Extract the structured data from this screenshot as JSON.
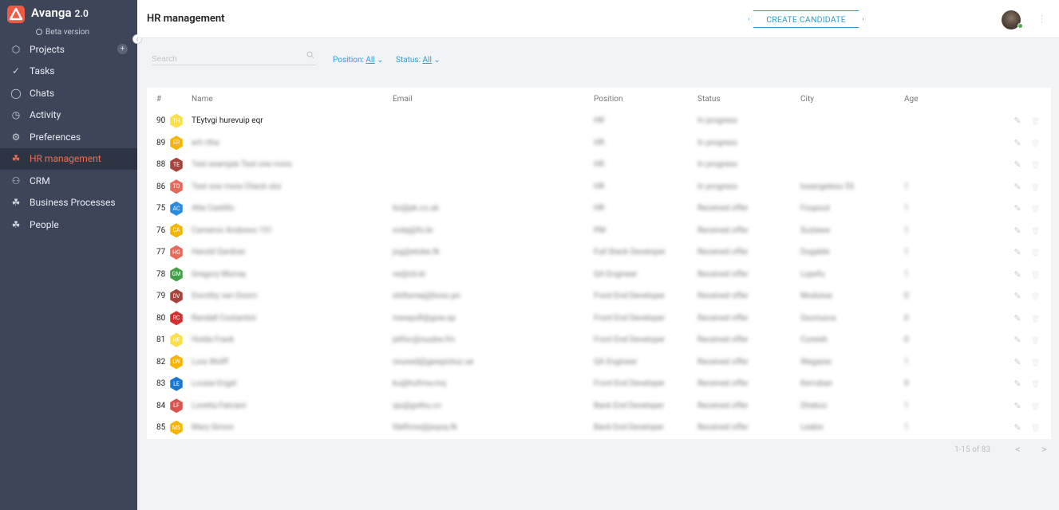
{
  "app": {
    "name": "Avanga",
    "version": "2.0",
    "subtitle": "Beta version"
  },
  "sidebar": {
    "items": [
      {
        "label": "Projects",
        "icon": "cube-icon"
      },
      {
        "label": "Tasks",
        "icon": "check-circle-icon"
      },
      {
        "label": "Chats",
        "icon": "chat-bubble-icon"
      },
      {
        "label": "Activity",
        "icon": "stopwatch-icon"
      },
      {
        "label": "Preferences",
        "icon": "gear-icon"
      },
      {
        "label": "HR management",
        "icon": "people-cluster-icon",
        "active": true
      },
      {
        "label": "CRM",
        "icon": "team-icon"
      },
      {
        "label": "Business Processes",
        "icon": "people-cluster-icon"
      },
      {
        "label": "People",
        "icon": "people-cluster-icon"
      }
    ],
    "add_symbol": "+",
    "collapse_symbol": "‹"
  },
  "header": {
    "title": "HR management",
    "create_button": "CREATE CANDIDATE"
  },
  "filters": {
    "search_placeholder": "Search",
    "position_label": "Position:",
    "position_value": "All",
    "status_label": "Status:",
    "status_value": "All"
  },
  "table": {
    "columns": [
      "#",
      "Name",
      "Email",
      "Position",
      "Status",
      "City",
      "Age"
    ],
    "rows": [
      {
        "id": "90",
        "initials": "TH",
        "color": "#fde047",
        "name": "TEytvgi hurevuip eqr",
        "email": "",
        "position": "HR",
        "status": "In progress",
        "city": "",
        "age": ""
      },
      {
        "id": "89",
        "initials": "ER",
        "color": "#f5b400",
        "name": "erh rtha",
        "email": "",
        "position": "HR",
        "status": "In progress",
        "city": "",
        "age": ""
      },
      {
        "id": "88",
        "initials": "TE",
        "color": "#a5443a",
        "name": "Test example Test one more",
        "email": "",
        "position": "HR",
        "status": "In progress",
        "city": "",
        "age": ""
      },
      {
        "id": "86",
        "initials": "TO",
        "color": "#e8685a",
        "name": "Test one more Check ului",
        "email": "",
        "position": "HR",
        "status": "In progress",
        "city": "losangeless 55",
        "age": "1"
      },
      {
        "id": "75",
        "initials": "AC",
        "color": "#2a8ae0",
        "name": "Alta Castillo",
        "email": "bo@pk.co.uk",
        "position": "HR",
        "status": "Received offer",
        "city": "Foupout",
        "age": "1"
      },
      {
        "id": "76",
        "initials": "CA",
        "color": "#f5b400",
        "name": "Cameron Andrews 151",
        "email": "nolej@fo.br",
        "position": "PM",
        "status": "Received offer",
        "city": "Suziewe",
        "age": "1"
      },
      {
        "id": "77",
        "initials": "HG",
        "color": "#e8685a",
        "name": "Harold Gardner",
        "email": "jog@etube.fk",
        "position": "Full Stack Developer",
        "status": "Received offer",
        "city": "Dugable",
        "age": "1"
      },
      {
        "id": "78",
        "initials": "GM",
        "color": "#43a047",
        "name": "Gregory Murray",
        "email": "ne@cb.kr",
        "position": "QA Engineer",
        "status": "Received offer",
        "city": "Lupefu",
        "age": "1"
      },
      {
        "id": "79",
        "initials": "DV",
        "color": "#a5443a",
        "name": "Dorothy van Doorn",
        "email": "shiltsmej@bosz.pn",
        "position": "Front End Developer",
        "status": "Received offer",
        "city": "Modutue",
        "age": "0"
      },
      {
        "id": "80",
        "initials": "RC",
        "color": "#d32f2f",
        "name": "Randall Costantini",
        "email": "mewpufi@gow.sp",
        "position": "Front End Developer",
        "status": "Received offer",
        "city": "Gsoriusva",
        "age": "0"
      },
      {
        "id": "81",
        "initials": "HF",
        "color": "#fde047",
        "name": "Hulda Frank",
        "email": "jetfoc@nuubw.fm",
        "position": "Front End Developer",
        "status": "Received offer",
        "city": "Curewb",
        "age": "0"
      },
      {
        "id": "82",
        "initials": "LW",
        "color": "#f5b400",
        "name": "Lora Wolff",
        "email": "nnuned@gewpiotuz.ue",
        "position": "QA Engineer",
        "status": "Received offer",
        "city": "Wegaras",
        "age": "1"
      },
      {
        "id": "83",
        "initials": "LE",
        "color": "#1976d2",
        "name": "Louise Engel",
        "email": "ku@hufmw.mq",
        "position": "Front End Developer",
        "status": "Received offer",
        "city": "Kerruban",
        "age": "0"
      },
      {
        "id": "84",
        "initials": "LF",
        "color": "#d9534f",
        "name": "Loretta Falciani",
        "email": "sju@gothu.cn",
        "position": "Back End Developer",
        "status": "Received offer",
        "city": "Dheboz",
        "age": "1"
      },
      {
        "id": "85",
        "initials": "MS",
        "color": "#f5b400",
        "name": "Mary Simon",
        "email": "fdefimw@jsqoq.fk",
        "position": "Back End Developer",
        "status": "Received offer",
        "city": "Leabic",
        "age": "1"
      }
    ]
  },
  "pagination": {
    "label": "1-15 of 83",
    "prev": "<",
    "next": ">"
  }
}
